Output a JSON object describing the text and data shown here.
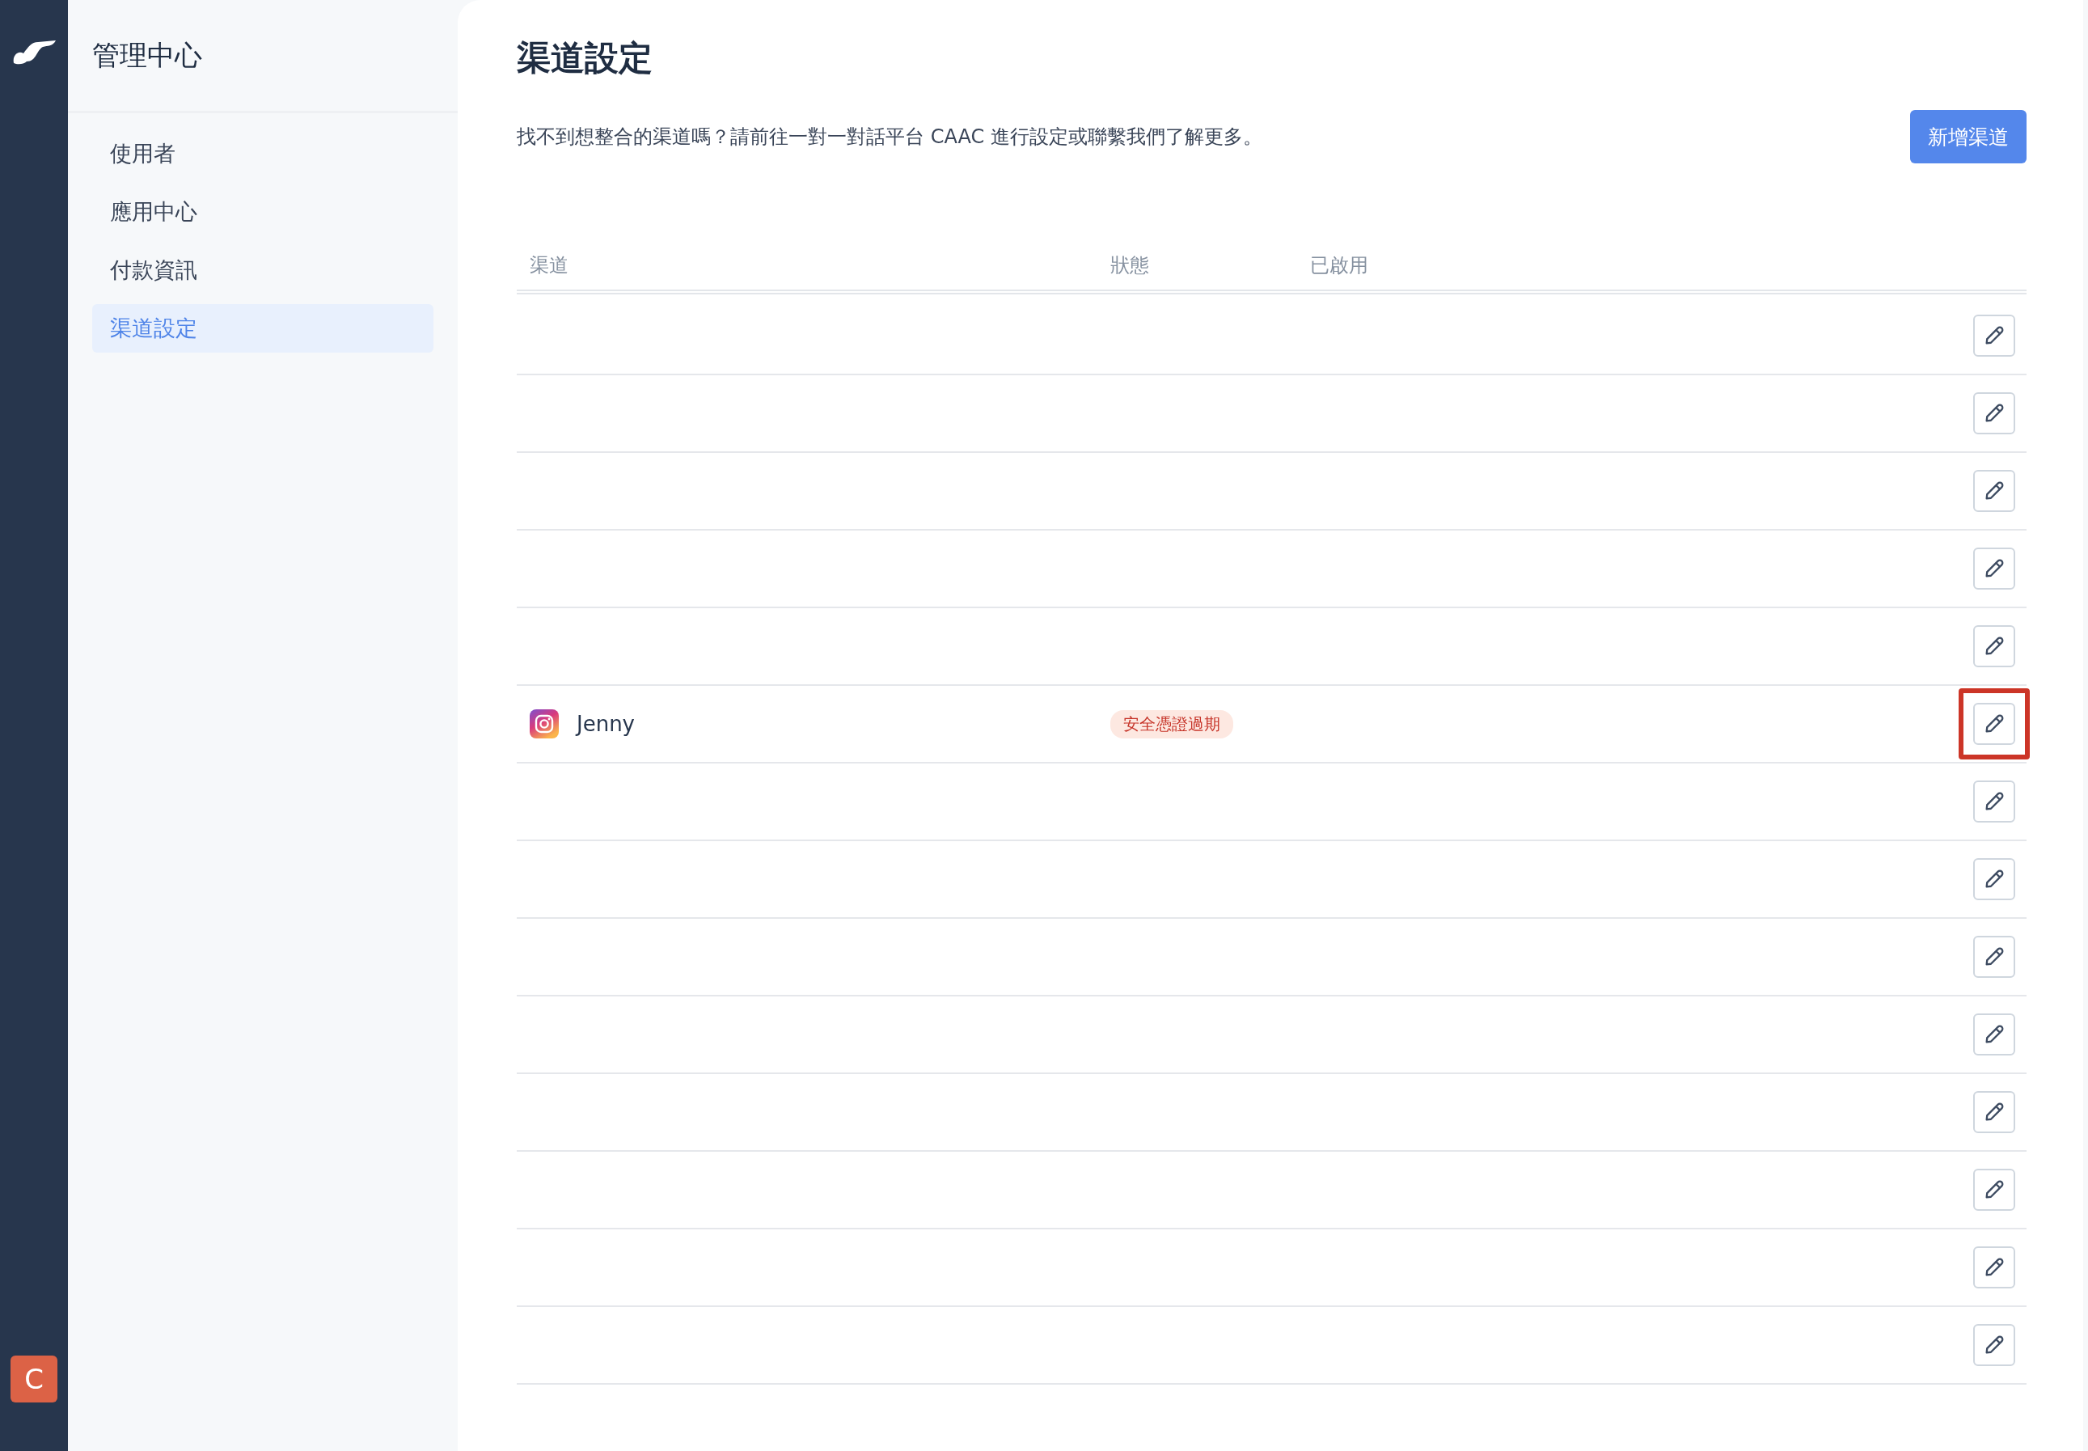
{
  "rail": {
    "avatar": "C"
  },
  "sidebar": {
    "title": "管理中心",
    "items": [
      {
        "label": "使用者",
        "selected": false
      },
      {
        "label": "應用中心",
        "selected": false
      },
      {
        "label": "付款資訊",
        "selected": false
      },
      {
        "label": "渠道設定",
        "selected": true
      }
    ]
  },
  "main": {
    "title": "渠道設定",
    "description": "找不到想整合的渠道嗎？請前往一對一對話平台 CAAC 進行設定或聯繫我們了解更多。",
    "add_button": "新增渠道"
  },
  "table": {
    "columns": [
      "渠道",
      "狀態",
      "已啟用"
    ],
    "rows": [
      {
        "highlighted": false
      },
      {
        "highlighted": false
      },
      {
        "highlighted": false
      },
      {
        "highlighted": false
      },
      {
        "highlighted": false
      },
      {
        "channel": {
          "kind": "instagram",
          "name": "Jenny"
        },
        "status": "安全憑證過期",
        "highlighted": true
      },
      {
        "highlighted": false
      },
      {
        "highlighted": false
      },
      {
        "highlighted": false
      },
      {
        "highlighted": false
      },
      {
        "highlighted": false
      },
      {
        "highlighted": false
      },
      {
        "highlighted": false
      },
      {
        "highlighted": false
      }
    ]
  }
}
